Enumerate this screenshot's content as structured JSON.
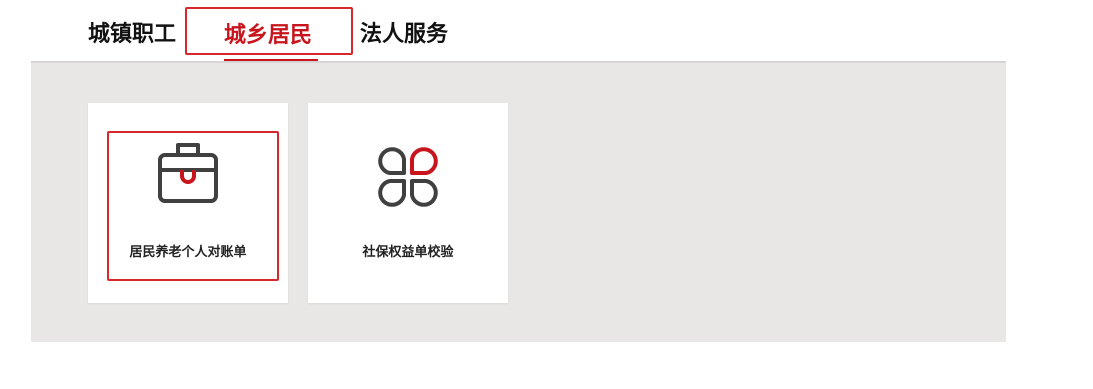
{
  "tabs": [
    {
      "label": "城镇职工"
    },
    {
      "label": "城乡居民"
    },
    {
      "label": "法人服务"
    }
  ],
  "cards": [
    {
      "label": "居民养老个人对账单",
      "icon": "briefcase-icon"
    },
    {
      "label": "社保权益单校验",
      "icon": "clover-icon"
    }
  ],
  "colors": {
    "accent": "#c8141c",
    "highlight": "#d9282b",
    "panel_bg": "#e8e7e5",
    "icon_dark": "#404040"
  }
}
